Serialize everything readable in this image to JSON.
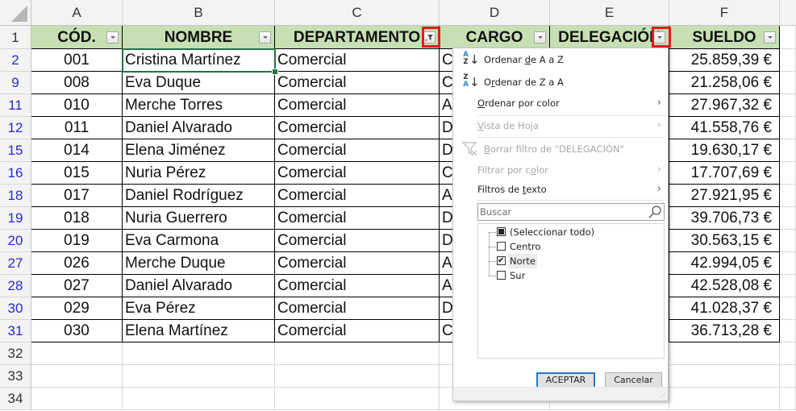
{
  "columns": [
    "A",
    "B",
    "C",
    "D",
    "E",
    "F"
  ],
  "header_row_number": "1",
  "table_headers": [
    {
      "label": "CÓD.",
      "filter_state": "none"
    },
    {
      "label": "NOMBRE",
      "filter_state": "none"
    },
    {
      "label": "DEPARTAMENTO",
      "filter_state": "filtered"
    },
    {
      "label": "CARGO",
      "filter_state": "none"
    },
    {
      "label": "DELEGACIÓN",
      "filter_state": "dropdown-open"
    },
    {
      "label": "SUELDO",
      "filter_state": "none"
    }
  ],
  "rows": [
    {
      "row": "2",
      "cod": "001",
      "nombre": "Cristina Martínez",
      "departamento": "Comercial",
      "cargo": "C",
      "sueldo": "25.859,39 €"
    },
    {
      "row": "9",
      "cod": "008",
      "nombre": "Eva Duque",
      "departamento": "Comercial",
      "cargo": "C",
      "sueldo": "21.258,06 €"
    },
    {
      "row": "11",
      "cod": "010",
      "nombre": "Merche Torres",
      "departamento": "Comercial",
      "cargo": "A",
      "sueldo": "27.967,32 €"
    },
    {
      "row": "12",
      "cod": "011",
      "nombre": "Daniel Alvarado",
      "departamento": "Comercial",
      "cargo": "D",
      "sueldo": "41.558,76 €"
    },
    {
      "row": "15",
      "cod": "014",
      "nombre": "Elena Jiménez",
      "departamento": "Comercial",
      "cargo": "D",
      "sueldo": "19.630,17 €"
    },
    {
      "row": "16",
      "cod": "015",
      "nombre": "Nuria Pérez",
      "departamento": "Comercial",
      "cargo": "C",
      "sueldo": "17.707,69 €"
    },
    {
      "row": "18",
      "cod": "017",
      "nombre": "Daniel Rodríguez",
      "departamento": "Comercial",
      "cargo": "A",
      "sueldo": "27.921,95 €"
    },
    {
      "row": "19",
      "cod": "018",
      "nombre": "Nuria Guerrero",
      "departamento": "Comercial",
      "cargo": "D",
      "sueldo": "39.706,73 €"
    },
    {
      "row": "20",
      "cod": "019",
      "nombre": "Eva Carmona",
      "departamento": "Comercial",
      "cargo": "D",
      "sueldo": "30.563,15 €"
    },
    {
      "row": "27",
      "cod": "026",
      "nombre": "Merche Duque",
      "departamento": "Comercial",
      "cargo": "A",
      "sueldo": "42.994,05 €"
    },
    {
      "row": "28",
      "cod": "027",
      "nombre": "Daniel Alvarado",
      "departamento": "Comercial",
      "cargo": "A",
      "sueldo": "42.528,08 €"
    },
    {
      "row": "30",
      "cod": "029",
      "nombre": "Eva Pérez",
      "departamento": "Comercial",
      "cargo": "D",
      "sueldo": "41.028,37 €"
    },
    {
      "row": "31",
      "cod": "030",
      "nombre": "Elena Martínez",
      "departamento": "Comercial",
      "cargo": "C",
      "sueldo": "36.713,28 €"
    }
  ],
  "empty_rows": [
    "32",
    "33",
    "34"
  ],
  "selected_cell": "B2",
  "dropdown": {
    "sort_az": {
      "pre": "Ordenar ",
      "key": "d",
      "post": "e A a Z"
    },
    "sort_za": {
      "pre": "O",
      "key": "r",
      "post": "denar de Z a A"
    },
    "sort_by_color": {
      "pre": "",
      "key": "O",
      "post": "rdenar por color"
    },
    "sheet_view": {
      "pre": "",
      "key": "V",
      "post": "ista de Hoja"
    },
    "clear_filter": {
      "pre": "",
      "key": "B",
      "post": "orrar filtro de \"DELEGACIÓN\""
    },
    "filter_by_color": {
      "pre": "Filtrar por c",
      "key": "o",
      "post": "lor"
    },
    "text_filters": {
      "pre": "Filtros de ",
      "key": "t",
      "post": "exto"
    },
    "search_placeholder": "Buscar",
    "list": [
      {
        "label": "(Seleccionar todo)",
        "state": "partial"
      },
      {
        "label": "Centro",
        "state": "unchecked"
      },
      {
        "label": "Norte",
        "state": "checked"
      },
      {
        "label": "Sur",
        "state": "unchecked"
      }
    ],
    "ok_label": "ACEPTAR",
    "cancel_label": "Cancelar"
  },
  "colors": {
    "header_fill": "#c6e0b4",
    "selection": "#217346",
    "highlight": "#e11b1b",
    "row_number": "#2a2ac8",
    "primary_button_border": "#2b78c4"
  }
}
